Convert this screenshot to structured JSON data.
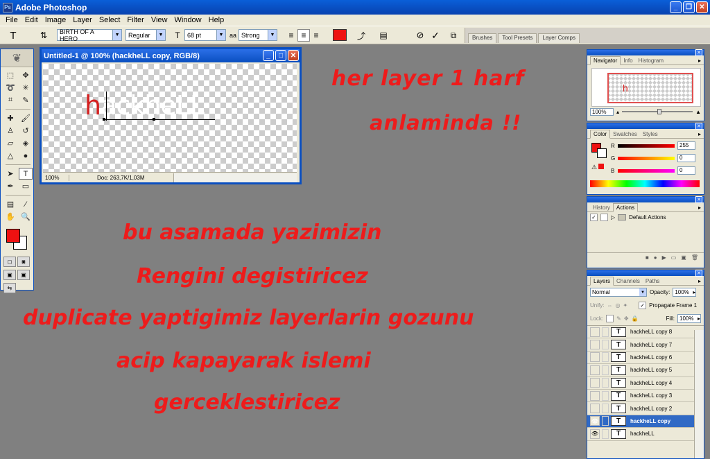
{
  "app": {
    "title": "Adobe Photoshop",
    "menu": [
      "File",
      "Edit",
      "Image",
      "Layer",
      "Select",
      "Filter",
      "View",
      "Window",
      "Help"
    ]
  },
  "options": {
    "font_family": "BIRTH OF A HERO",
    "font_style": "Regular",
    "font_size": "68 pt",
    "aa_label": "a",
    "antialias": "Strong",
    "text_color": "#ee1111",
    "well_tabs": [
      "Brushes",
      "Tool Presets",
      "Layer Comps"
    ]
  },
  "document": {
    "title": "Untitled-1 @ 100% (hackheLL copy, RGB/8)",
    "canvas_first": "h",
    "canvas_rest": "ackheLL",
    "zoom": "100%",
    "doc_info": "Doc: 263,7K/1,03M"
  },
  "notes": {
    "line1": "her layer 1 harf",
    "line2": "anlaminda !!",
    "line3": "bu asamada yazimizin",
    "line4": "Rengini degistiricez",
    "line5": "duplicate yaptigimiz layerlarin gozunu",
    "line6": "acip kapayarak islemi",
    "line7": "gerceklestiricez"
  },
  "navigator": {
    "tabs": [
      "Navigator",
      "Info",
      "Histogram"
    ],
    "thumb_letter": "h",
    "zoom": "100%"
  },
  "color": {
    "tabs": [
      "Color",
      "Swatches",
      "Styles"
    ],
    "r_label": "R",
    "g_label": "G",
    "b_label": "B",
    "r": "255",
    "g": "0",
    "b": "0"
  },
  "history": {
    "tabs": [
      "History",
      "Actions"
    ],
    "action_set": "Default Actions"
  },
  "layers": {
    "tabs": [
      "Layers",
      "Channels",
      "Paths"
    ],
    "blend_mode": "Normal",
    "opacity_label": "Opacity:",
    "opacity": "100%",
    "unify_label": "Unify:",
    "propagate_label": "Propagate Frame 1",
    "lock_label": "Lock:",
    "fill_label": "Fill:",
    "fill": "100%",
    "type_glyph": "T",
    "items": [
      {
        "name": "hackheLL copy 8",
        "visible": false,
        "selected": false
      },
      {
        "name": "hackheLL copy 7",
        "visible": false,
        "selected": false
      },
      {
        "name": "hackheLL copy 6",
        "visible": false,
        "selected": false
      },
      {
        "name": "hackheLL copy 5",
        "visible": false,
        "selected": false
      },
      {
        "name": "hackheLL copy 4",
        "visible": false,
        "selected": false
      },
      {
        "name": "hackheLL copy 3",
        "visible": false,
        "selected": false
      },
      {
        "name": "hackheLL copy 2",
        "visible": false,
        "selected": false
      },
      {
        "name": "hackheLL copy",
        "visible": true,
        "selected": true
      },
      {
        "name": "hackheLL",
        "visible": true,
        "selected": false
      }
    ]
  },
  "colors": {
    "foreground": "#ee1111",
    "background": "#ffffff",
    "title_blue": "#0a4fc0",
    "selection": "#316ac5"
  }
}
